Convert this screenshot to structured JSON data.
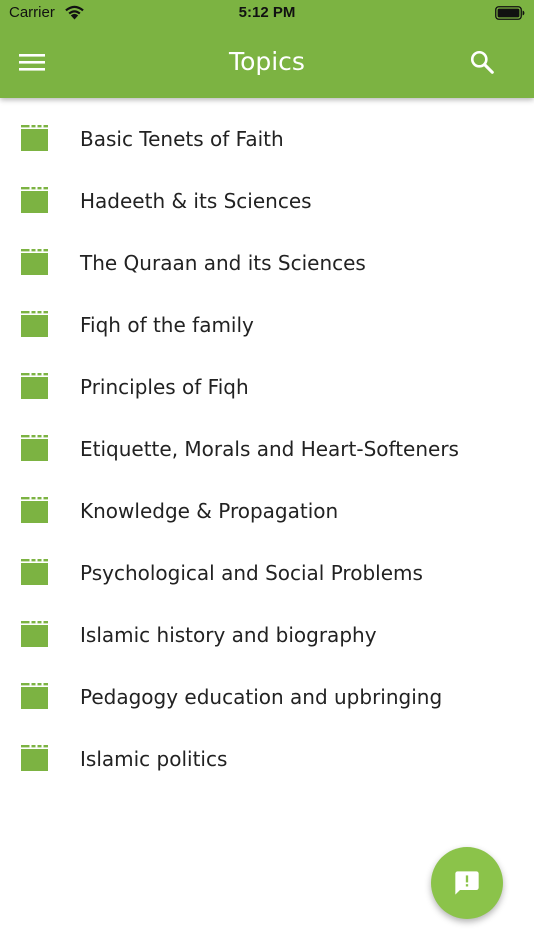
{
  "status_bar": {
    "carrier": "Carrier",
    "time": "5:12 PM"
  },
  "app_bar": {
    "title": "Topics",
    "menu_icon": "hamburger-menu-icon",
    "search_icon": "search-icon"
  },
  "topics": [
    {
      "label": "Basic Tenets of Faith",
      "icon": "folder-icon"
    },
    {
      "label": "Hadeeth & its Sciences",
      "icon": "folder-icon"
    },
    {
      "label": "The Quraan and its Sciences",
      "icon": "folder-icon"
    },
    {
      "label": "Fiqh of the family",
      "icon": "folder-icon"
    },
    {
      "label": "Principles of Fiqh",
      "icon": "folder-icon"
    },
    {
      "label": "Etiquette, Morals and Heart-Softeners",
      "icon": "folder-icon"
    },
    {
      "label": "Knowledge & Propagation",
      "icon": "folder-icon"
    },
    {
      "label": "Psychological and Social Problems",
      "icon": "folder-icon"
    },
    {
      "label": "Islamic history and biography",
      "icon": "folder-icon"
    },
    {
      "label": "Pedagogy education and upbringing",
      "icon": "folder-icon"
    },
    {
      "label": "Islamic politics",
      "icon": "folder-icon"
    }
  ],
  "fab": {
    "icon": "feedback-icon"
  },
  "colors": {
    "primary": "#7cb342",
    "fab": "#8bc34a",
    "text": "#222222"
  }
}
